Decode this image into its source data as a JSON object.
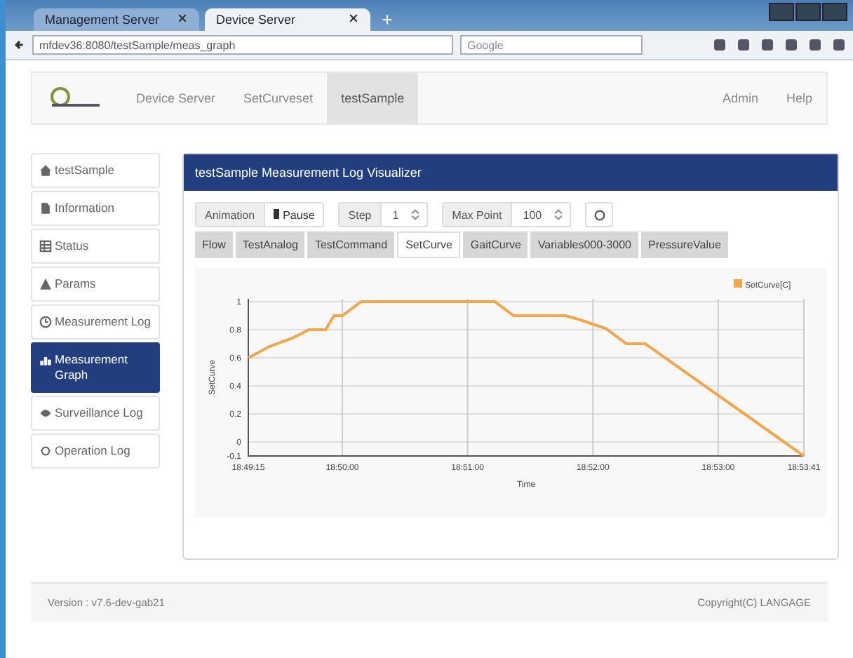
{
  "browser": {
    "tabs": [
      {
        "label": "Management Server",
        "selected": false
      },
      {
        "label": "Device Server",
        "selected": true
      }
    ],
    "url": "mfdev36:8080/testSample/meas_graph",
    "search": {
      "placeholder": "Google"
    }
  },
  "nav": {
    "items": [
      {
        "label": "Device Server",
        "selected": false
      },
      {
        "label": "SetCurveset",
        "selected": false
      },
      {
        "label": "testSample",
        "selected": true
      }
    ],
    "right": [
      "Admin",
      "Help"
    ]
  },
  "sidebar": {
    "items": [
      {
        "label": "testSample",
        "selected": false
      },
      {
        "label": "Information",
        "selected": false
      },
      {
        "label": "Status",
        "selected": false
      },
      {
        "label": "Params",
        "selected": false
      },
      {
        "label": "Measurement Log",
        "selected": false
      },
      {
        "label": "Measurement Graph",
        "selected": true
      },
      {
        "label": "Surveillance Log",
        "selected": false
      },
      {
        "label": "Operation Log",
        "selected": false
      }
    ]
  },
  "panel": {
    "title": "testSample Measurement Log Visualizer",
    "controls": {
      "animation_label": "Animation",
      "pause_button": "Pause",
      "step_label": "Step",
      "step_value": "1",
      "max_label": "Max Point",
      "max_value": "100"
    },
    "tabs": [
      {
        "label": "Flow",
        "selected": false
      },
      {
        "label": "TestAnalog",
        "selected": false
      },
      {
        "label": "TestCommand",
        "selected": false
      },
      {
        "label": "SetCurve",
        "selected": true
      },
      {
        "label": "GaitCurve",
        "selected": false
      },
      {
        "label": "Variables000-3000",
        "selected": false
      },
      {
        "label": "PressureValue",
        "selected": false
      }
    ],
    "chart_data": {
      "type": "line",
      "xlabel": "Time",
      "ylabel": "SetCurve",
      "x": [
        67755,
        67765,
        67776,
        67784,
        67792,
        67796,
        67800,
        67809,
        67873,
        67882,
        67907,
        67914,
        67926,
        67936,
        67945,
        68021
      ],
      "series": [
        {
          "name": "SetCurve[C]",
          "color": "#f5a64a",
          "values": [
            0.6,
            0.68,
            0.74,
            0.8,
            0.8,
            0.9,
            0.9,
            1,
            1,
            0.9,
            0.9,
            0.87,
            0.81,
            0.7,
            0.7,
            -0.1
          ]
        }
      ],
      "grid": true,
      "xlim": [
        67755,
        68021
      ],
      "ylim": [
        -0.1,
        1.02
      ],
      "xticks": [
        {
          "value": 67755,
          "label": "18:49:15"
        },
        {
          "value": 67800,
          "label": "18:50:00"
        },
        {
          "value": 67860,
          "label": "18:51:00"
        },
        {
          "value": 67920,
          "label": "18:52:00"
        },
        {
          "value": 67980,
          "label": "18:53:00"
        },
        {
          "value": 68021,
          "label": "18:53:41"
        }
      ],
      "yticks": [
        1,
        0.8,
        0.6,
        0.4,
        0.2,
        0,
        -0.1
      ]
    }
  },
  "footer": {
    "version": "Version : v7.6-dev-gab21",
    "copyright": "Copyright(C) LANGAGE"
  }
}
